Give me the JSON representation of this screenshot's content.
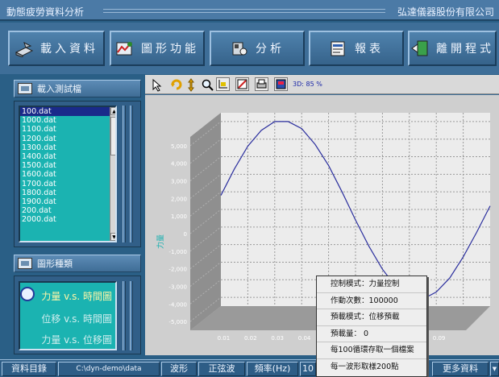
{
  "app": {
    "title": "動態疲勞資料分析",
    "company": "弘達儀器股份有限公司"
  },
  "toolbar": {
    "buttons": [
      {
        "label": "載入資料",
        "icon": "load-data-icon"
      },
      {
        "label": "圖形功能",
        "icon": "graph-function-icon"
      },
      {
        "label": "分析",
        "icon": "analysis-icon"
      },
      {
        "label": "報表",
        "icon": "report-icon"
      },
      {
        "label": "離開程式",
        "icon": "exit-icon"
      }
    ]
  },
  "load_panel": {
    "title": "載入測試檔",
    "files": [
      "100.dat",
      "1000.dat",
      "1100.dat",
      "1200.dat",
      "1300.dat",
      "1400.dat",
      "1500.dat",
      "1600.dat",
      "1700.dat",
      "1800.dat",
      "1900.dat",
      "200.dat",
      "2000.dat"
    ],
    "selected": "100.dat"
  },
  "chart_type_panel": {
    "title": "圖形種類",
    "options": [
      "力量 v.s. 時間圖",
      "位移 v.s. 時間圖",
      "力量 v.s. 位移圖"
    ],
    "selected": "力量 v.s. 時間圖"
  },
  "chart_toolbar": {
    "zoom_text": "3D: 85 %",
    "tools": [
      "pointer-icon",
      "rotate-icon",
      "move-icon",
      "zoom-icon",
      "axes-icon",
      "chart-edit-icon",
      "print-icon",
      "export-icon"
    ]
  },
  "chart_data": {
    "type": "line",
    "title": "",
    "ylabel": "力量",
    "xlabel": "",
    "yticks": [
      5000,
      4000,
      3000,
      2000,
      1000,
      0,
      -1000,
      -2000,
      -3000,
      -4000,
      -5000
    ],
    "ytick_labels": [
      "5,000",
      "4,000",
      "3,000",
      "2,000",
      "1,000",
      "0",
      "-1,000",
      "-2,000",
      "-3,000",
      "-4,000",
      "-5,000"
    ],
    "xtick_labels": [
      "0.01",
      "0.02",
      "0.03",
      "0.04",
      "0.09"
    ],
    "xticks": [
      0.01,
      0.02,
      0.03,
      0.04,
      0.09
    ],
    "ylim": [
      -5500,
      5500
    ],
    "xlim": [
      0.0,
      0.1
    ],
    "grid": true,
    "view": "3d",
    "series": [
      {
        "color": "#2b2f9e",
        "x": [
          0.0,
          0.005,
          0.01,
          0.015,
          0.02,
          0.025,
          0.03,
          0.035,
          0.04,
          0.045,
          0.05,
          0.055,
          0.06,
          0.065,
          0.07,
          0.075,
          0.08,
          0.085,
          0.09,
          0.095,
          0.1
        ],
        "y": [
          800,
          2300,
          3600,
          4500,
          5000,
          5000,
          4600,
          3700,
          2500,
          1000,
          -600,
          -2100,
          -3400,
          -4400,
          -5000,
          -5100,
          -4700,
          -3900,
          -2700,
          -1300,
          200
        ]
      }
    ]
  },
  "context_menu": {
    "items": [
      "控制模式：力量控制",
      "作動次數：100000",
      "預載模式：位移預載",
      "預載量：  0",
      "每100循環存取一個檔案",
      "每一波形取樣200點"
    ]
  },
  "statusbar": {
    "items": [
      "資料目錄",
      "C:\\dyn-demo\\data",
      "波形",
      "正弦波",
      "頻率(Hz)",
      "10",
      "更多資料"
    ]
  }
}
